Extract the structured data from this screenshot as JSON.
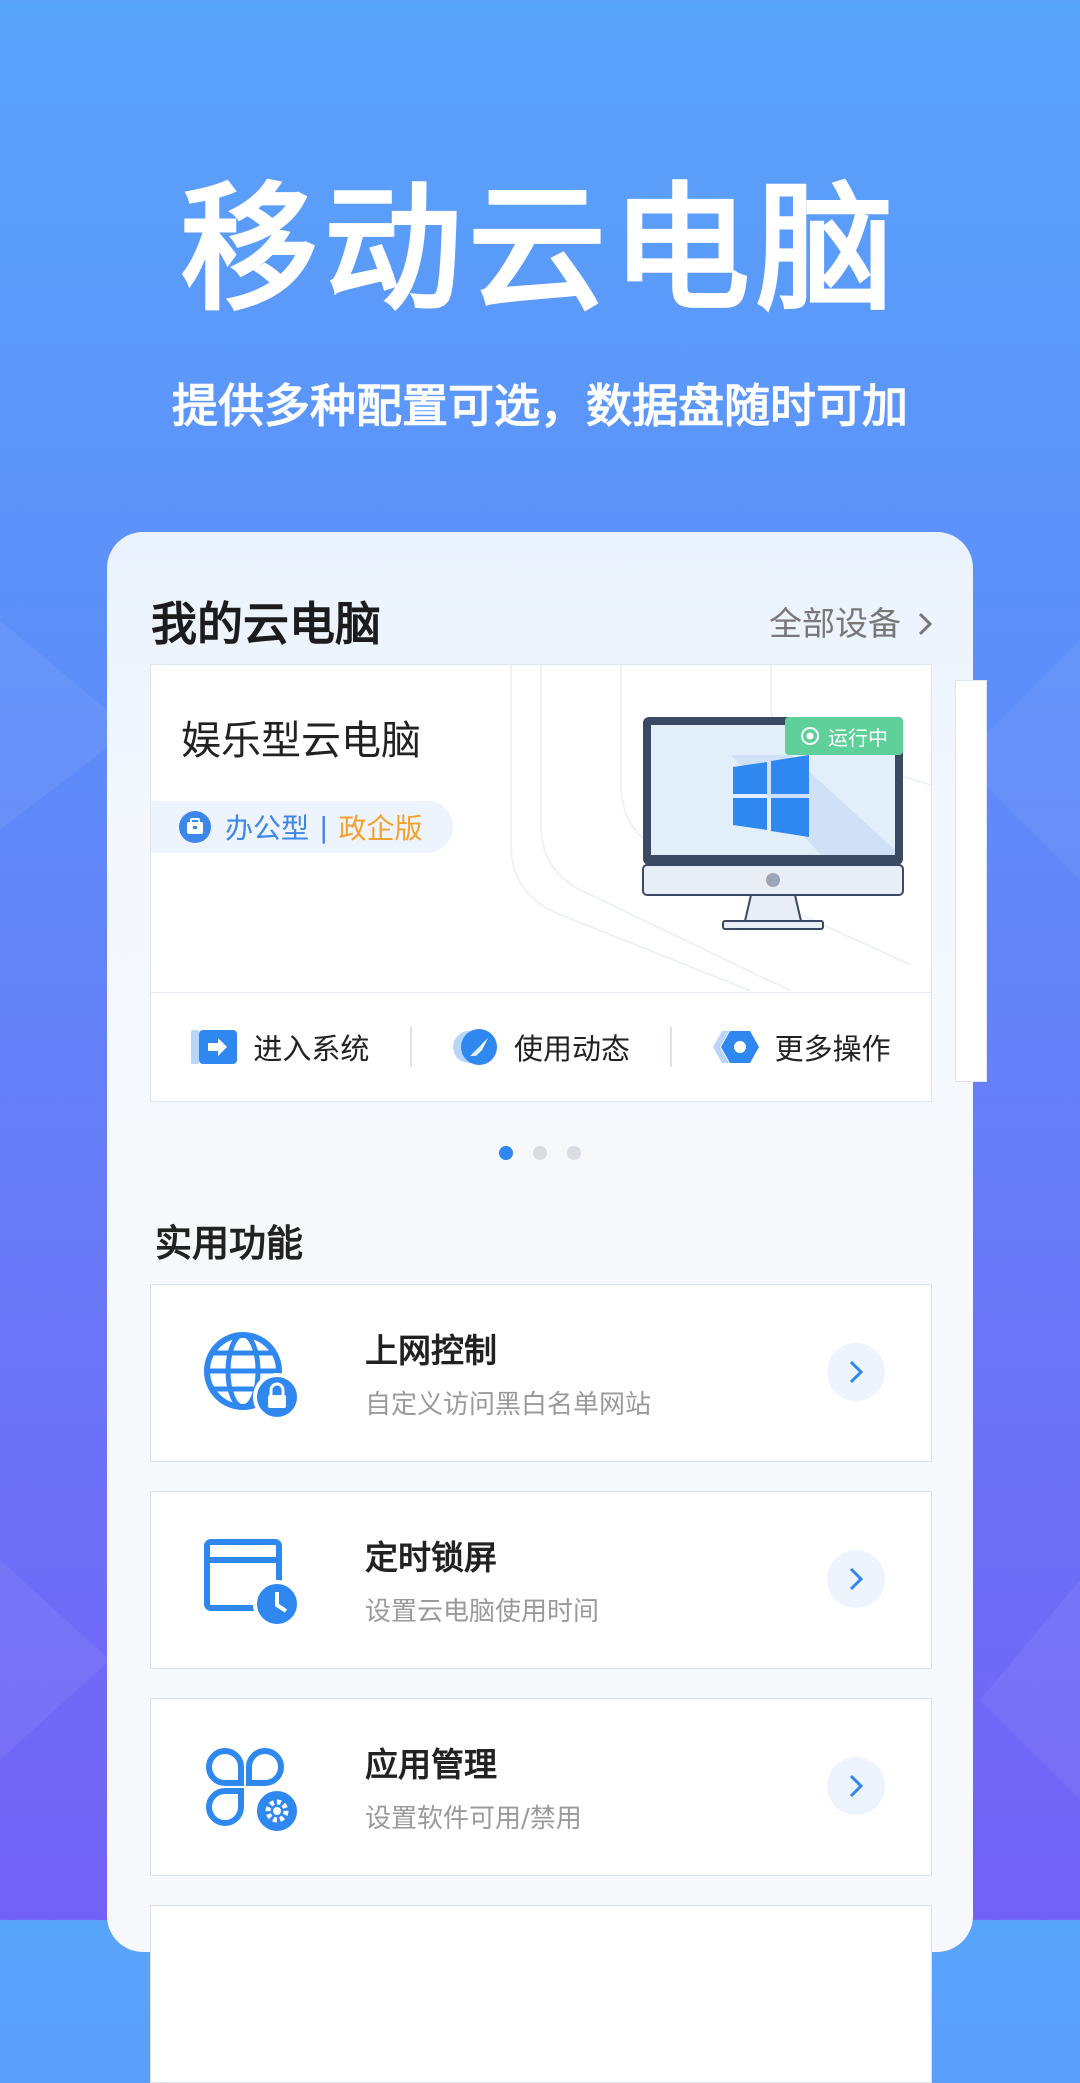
{
  "hero": {
    "title": "移动云电脑",
    "subtitle": "提供多种配置可选，数据盘随时可加"
  },
  "my_devices": {
    "title": "我的云电脑",
    "all_devices_label": "全部设备",
    "device": {
      "name": "娱乐型云电脑",
      "type": "办公型",
      "separator": "|",
      "edition": "政企版",
      "status": "运行中",
      "icons": [
        "briefcase-icon",
        "windows-logo-icon",
        "running-dot-icon"
      ]
    },
    "actions": [
      {
        "label": "进入系统",
        "icon": "enter-system-icon"
      },
      {
        "label": "使用动态",
        "icon": "compass-icon"
      },
      {
        "label": "更多操作",
        "icon": "more-hexagon-icon"
      }
    ],
    "carousel": {
      "pages": 3,
      "active": 1
    }
  },
  "features": {
    "title": "实用功能",
    "items": [
      {
        "title": "上网控制",
        "desc": "自定义访问黑白名单网站",
        "icon": "globe-lock-icon"
      },
      {
        "title": "定时锁屏",
        "desc": "设置云电脑使用时间",
        "icon": "window-clock-icon"
      },
      {
        "title": "应用管理",
        "desc": "设置软件可用/禁用",
        "icon": "apps-gear-icon"
      }
    ]
  },
  "colors": {
    "accent": "#2f87f0",
    "status": "#5fd09a",
    "edition": "#f2a12c",
    "background_top": "#59a4fb",
    "background_bottom": "#7361f6"
  }
}
